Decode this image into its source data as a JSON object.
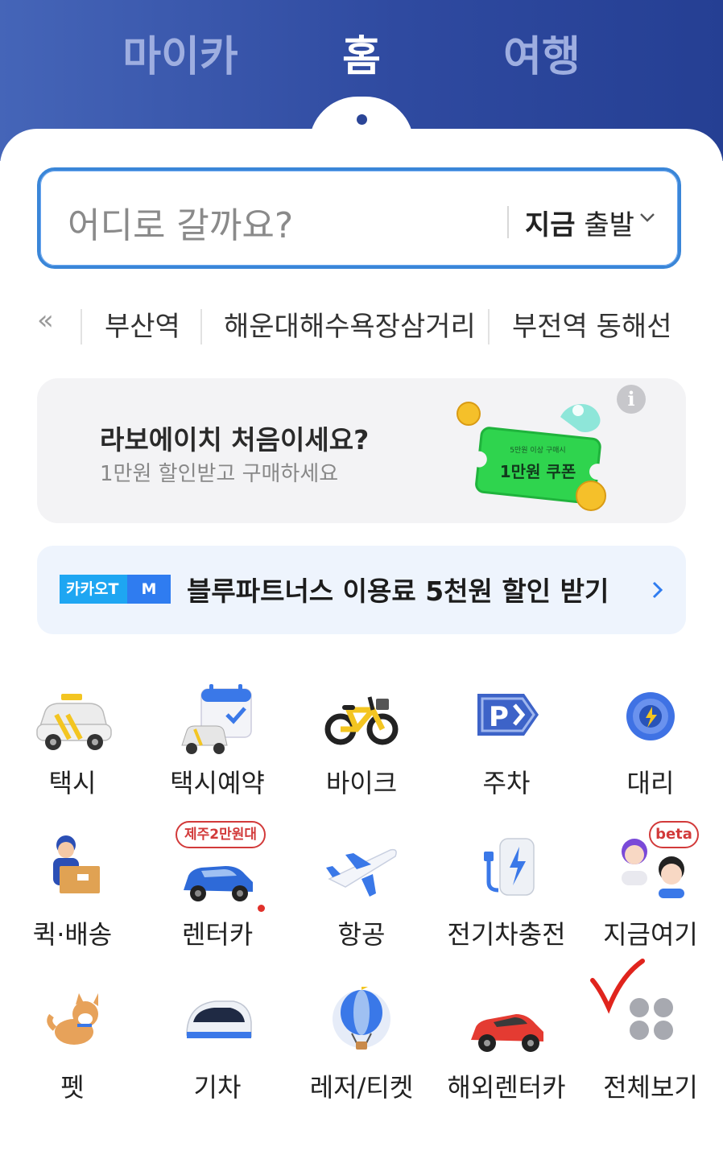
{
  "header": {
    "tabs": [
      {
        "label": "마이카"
      },
      {
        "label": "홈"
      },
      {
        "label": "여행"
      }
    ],
    "active_tab": "홈"
  },
  "search": {
    "placeholder": "어디로 갈까요?",
    "depart_when": "지금",
    "depart_label": "출발"
  },
  "recent_places": {
    "items": [
      "부산역",
      "해운대해수욕장삼거리",
      "부전역 동해선"
    ]
  },
  "promo": {
    "title": "라보에이치 처음이세요?",
    "subtitle": "1만원 할인받고 구매하세요",
    "coupon_top": "5만원 이상 구매시",
    "coupon_main": "1만원 쿠폰"
  },
  "banner": {
    "badge_left": "카카오T",
    "badge_right": "M",
    "text": "블루파트너스 이용료 5천원 할인 받기"
  },
  "services": {
    "row1": [
      "택시",
      "택시예약",
      "바이크",
      "주차",
      "대리"
    ],
    "row2": [
      "퀵·배송",
      "렌터카",
      "항공",
      "전기차충전",
      "지금여기"
    ],
    "row3": [
      "펫",
      "기차",
      "레저/티켓",
      "해외렌터카",
      "전체보기"
    ],
    "rentcar_tag": "제주2만원대",
    "here_tag": "beta"
  },
  "colors": {
    "header_gradient_start": "#4565b8",
    "header_gradient_end": "#253f93",
    "accent_blue": "#2f7cf0",
    "search_border": "#3a86d8",
    "banner_bg": "#eef4fd",
    "tag_red": "#d23a3a"
  }
}
